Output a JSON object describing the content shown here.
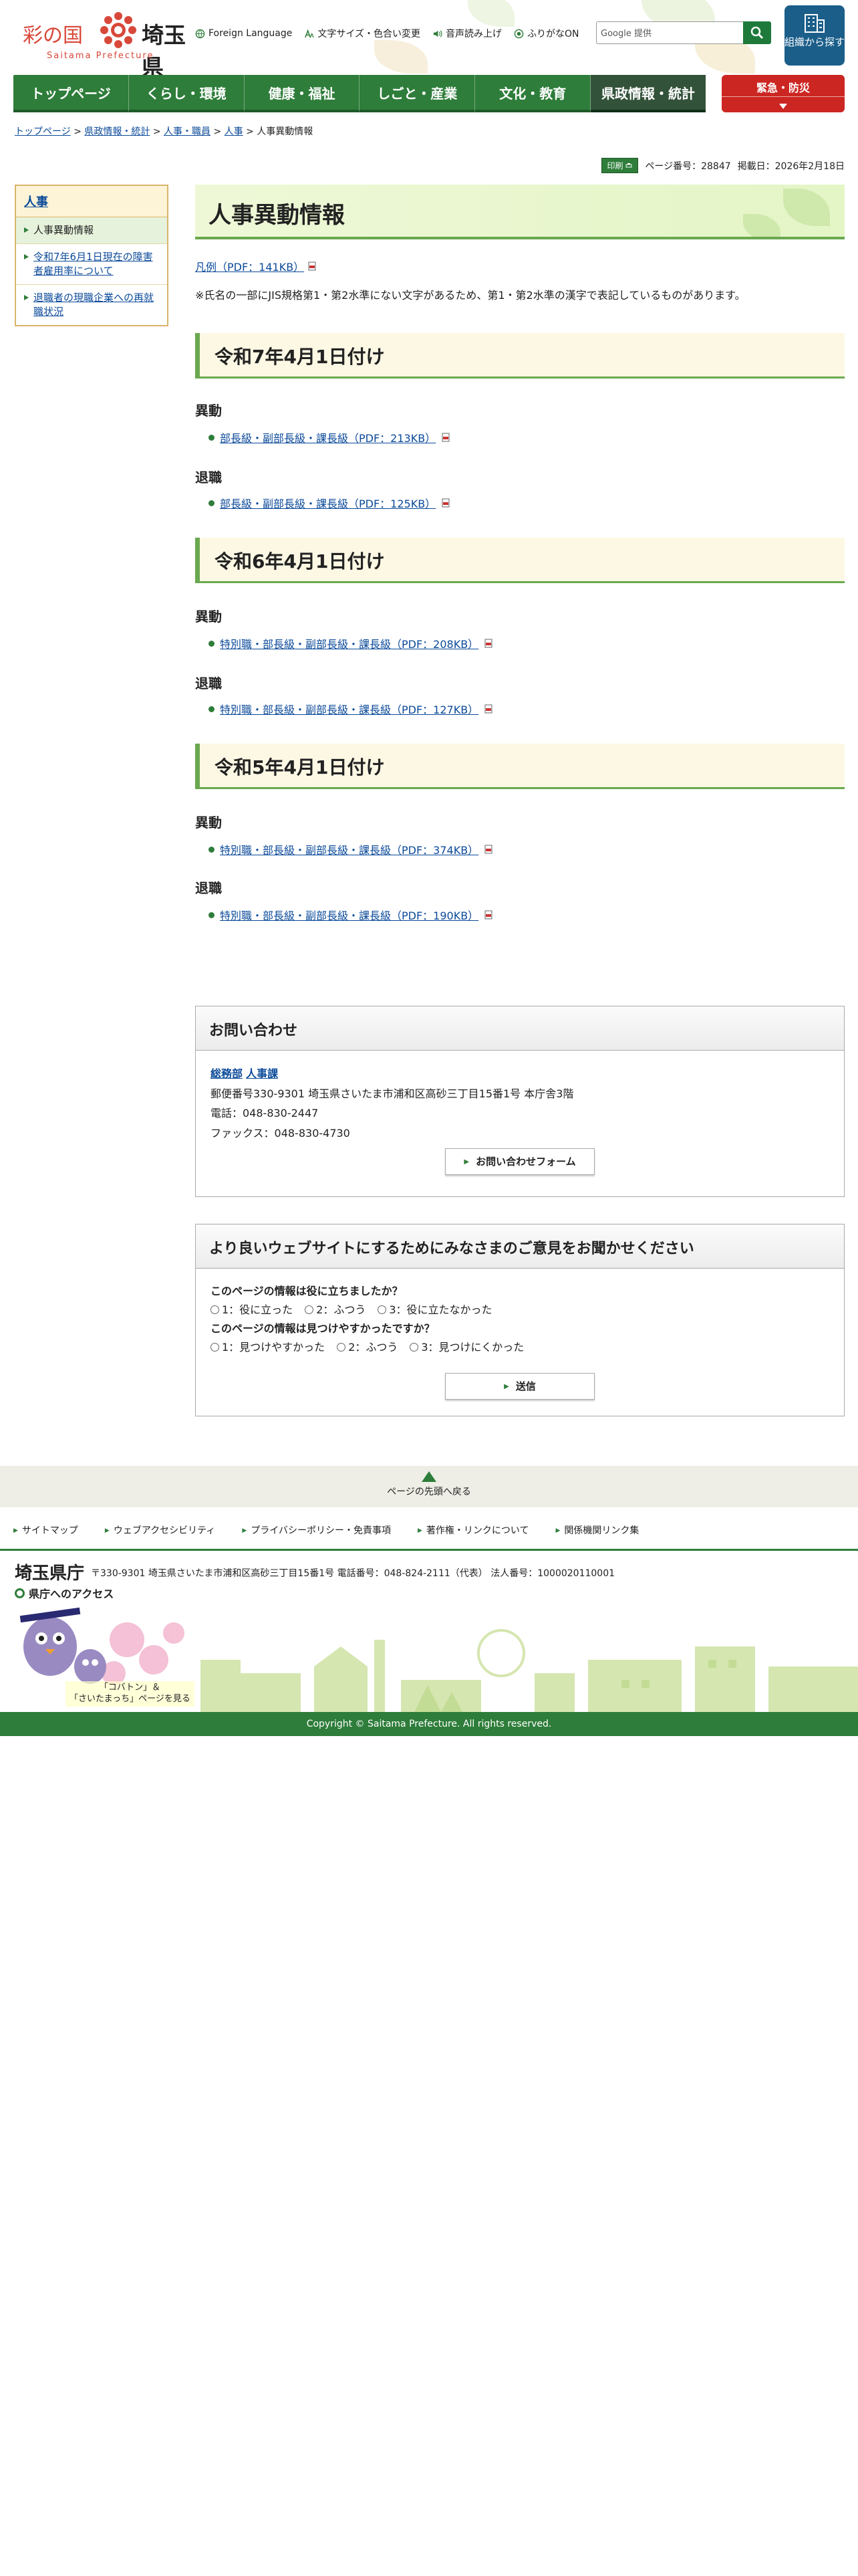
{
  "header": {
    "logo_left": "彩の国",
    "logo_right": "埼玉県",
    "logo_sub": "Saitama Prefecture",
    "util": [
      {
        "label": "Foreign Language",
        "icon": "globe-icon"
      },
      {
        "label": "文字サイズ・色合い変更",
        "icon": "text-size-icon"
      },
      {
        "label": "音声読み上げ",
        "icon": "speaker-icon"
      },
      {
        "label": "ふりがなON",
        "icon": "furigana-icon"
      }
    ],
    "search_placeholder": "Google 提供",
    "search_icon": "search-icon",
    "org_button": "組織から探す",
    "colors": {
      "primary": "#2e7d3a",
      "emergency": "#cc2622",
      "org": "#1b5e8a"
    }
  },
  "nav": {
    "items": [
      "トップページ",
      "くらし・環境",
      "健康・福祉",
      "しごと・産業",
      "文化・教育",
      "県政情報・統計"
    ],
    "emergency": "緊急・防災"
  },
  "breadcrumb": [
    "トップページ",
    "県政情報・統計",
    "人事・職員",
    "人事",
    "人事異動情報"
  ],
  "meta": {
    "print": "印刷",
    "page_number": "ページ番号：28847",
    "published": "掲載日：2026年2月18日"
  },
  "sidebar": {
    "heading": "人事",
    "items": [
      "人事異動情報",
      "令和7年6月1日現在の障害者雇用率について",
      "退職者の現職企業への再就職状況"
    ]
  },
  "main": {
    "title": "人事異動情報",
    "legend": "凡例（PDF：141KB）",
    "note": "※氏名の一部にJIS規格第1・第2水準にない文字があるため、第1・第2水準の漢字で表記しているものがあります。",
    "sections": [
      {
        "heading": "令和7年4月1日付け",
        "groups": [
          {
            "label": "異動",
            "link": "部長級・副部長級・課長級（PDF：213KB）"
          },
          {
            "label": "退職",
            "link": "部長級・副部長級・課長級（PDF：125KB）"
          }
        ]
      },
      {
        "heading": "令和6年4月1日付け",
        "groups": [
          {
            "label": "異動",
            "link": "特別職・部長級・副部長級・課長級（PDF：208KB）"
          },
          {
            "label": "退職",
            "link": "特別職・部長級・副部長級・課長級（PDF：127KB）"
          }
        ]
      },
      {
        "heading": "令和5年4月1日付け",
        "groups": [
          {
            "label": "異動",
            "link": "特別職・部長級・副部長級・課長級（PDF：374KB）"
          },
          {
            "label": "退職",
            "link": "特別職・部長級・副部長級・課長級（PDF：190KB）"
          }
        ]
      }
    ]
  },
  "contact": {
    "heading": "お問い合わせ",
    "dept": "総務部",
    "section": "人事課",
    "address": "郵便番号330-9301 埼玉県さいたま市浦和区高砂三丁目15番1号 本庁舎3階",
    "tel": "電話：048-830-2447",
    "fax": "ファックス：048-830-4730",
    "form_button": "お問い合わせフォーム"
  },
  "feedback": {
    "heading": "より良いウェブサイトにするためにみなさまのご意見をお聞かせください",
    "q1": "このページの情報は役に立ちましたか？",
    "q1_opts": [
      "1：役に立った",
      "2：ふつう",
      "3：役に立たなかった"
    ],
    "q2": "このページの情報は見つけやすかったですか？",
    "q2_opts": [
      "1：見つけやすかった",
      "2：ふつう",
      "3：見つけにくかった"
    ],
    "submit": "送信"
  },
  "footer": {
    "pagetop": "ページの先頭へ戻る",
    "links": [
      "サイトマップ",
      "ウェブアクセシビリティ",
      "プライバシーポリシー・免責事項",
      "著作権・リンクについて",
      "関係機関リンク集"
    ],
    "pref_name": "埼玉県庁",
    "pref_addr": "〒330-9301 埼玉県さいたま市浦和区高砂三丁目15番1号 電話番号：048-824-2111（代表） 法人番号：1000020110001",
    "access": "県庁へのアクセス",
    "mascot_caption_1": "「コバトン」＆",
    "mascot_caption_2": "「さいたまっち」ページを見る",
    "copyright": "Copyright © Saitama Prefecture. All rights reserved."
  }
}
